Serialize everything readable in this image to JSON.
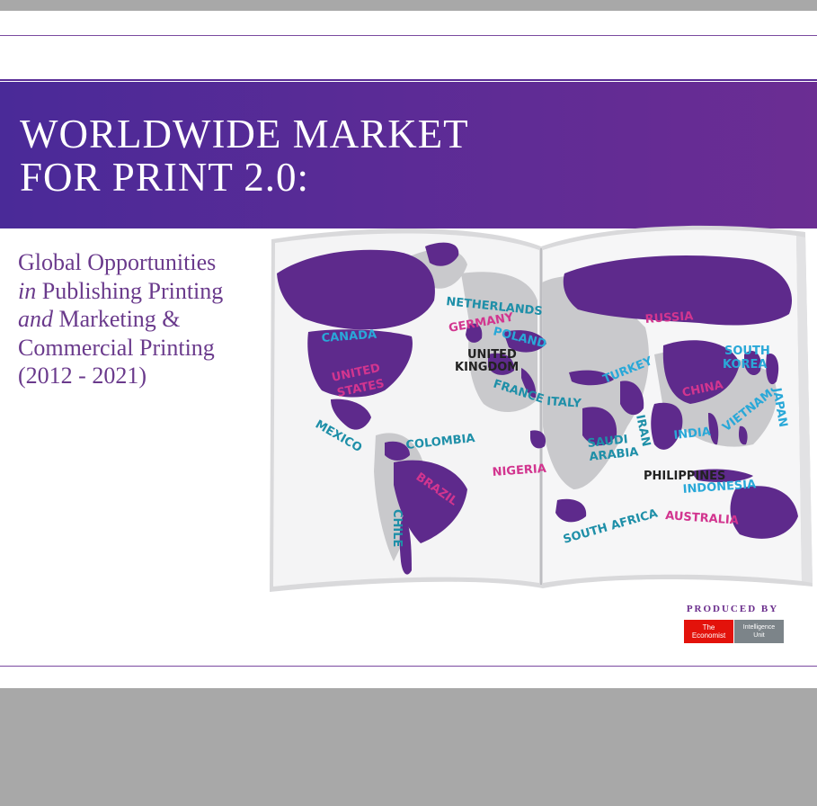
{
  "cover": {
    "title_line1": "WORLDWIDE MARKET",
    "title_line2": "FOR PRINT 2.0:",
    "subtitle": {
      "line1": "Global Opportunities",
      "line2_em": "in",
      "line2_rest": " Publishing Printing",
      "line3_em": "and",
      "line3_rest": " Marketing &",
      "line4": "Commercial Printing",
      "line5": "(2012 - 2021)"
    },
    "produced_by": "PRODUCED BY",
    "logo_left_line1": "The",
    "logo_left_line2": "Economist",
    "logo_right_line1": "Intelligence",
    "logo_right_line2": "Unit"
  },
  "map_labels": {
    "canada": "CANADA",
    "united_states_1": "UNITED",
    "united_states_2": "STATES",
    "mexico": "MEXICO",
    "colombia": "COLOMBIA",
    "brazil": "BRAZIL",
    "chile": "CHILE",
    "netherlands": "NETHERLANDS",
    "germany": "GERMANY",
    "poland": "POLAND",
    "uk_1": "UNITED",
    "uk_2": "KINGDOM",
    "france": "FRANCE",
    "italy": "ITALY",
    "nigeria": "NIGERIA",
    "south_africa": "SOUTH AFRICA",
    "russia": "RUSSIA",
    "turkey": "TURKEY",
    "saudi_1": "SAUDI",
    "saudi_2": "ARABIA",
    "iran": "IRAN",
    "china": "CHINA",
    "india": "INDIA",
    "south_korea_1": "SOUTH",
    "south_korea_2": "KOREA",
    "japan": "JAPAN",
    "vietnam": "VIETNAM",
    "philippines": "PHILIPPINES",
    "indonesia": "INDONESIA",
    "australia": "AUSTRALIA"
  },
  "colors": {
    "banner": "#5a2b96",
    "purple_land": "#5e2a8c",
    "gray_land": "#c9c9cc",
    "label_cyan": "#29a8d8",
    "label_pink": "#d2358f",
    "label_teal": "#1e8fa8",
    "label_dark": "#222222"
  }
}
